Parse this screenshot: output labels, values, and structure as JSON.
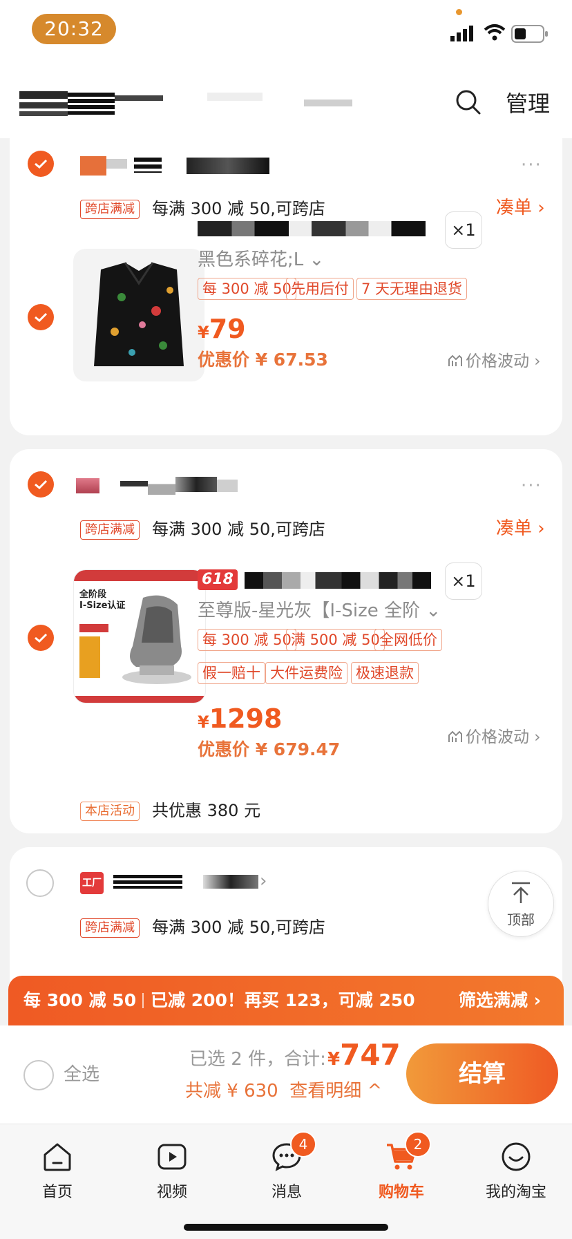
{
  "status_bar": {
    "time": "20:32"
  },
  "header": {
    "manage_label": "管理"
  },
  "stores": [
    {
      "promo_tag": "跨店满减",
      "promo_text": "每满 300 减 50,可跨店",
      "link": "凑单 ›",
      "item": {
        "variant": "黑色系碎花;L ⌄",
        "qty": "×1",
        "tags": [
          "每 300 减 50",
          "先用后付",
          "7 天无理由退货"
        ],
        "price_symbol": "¥",
        "price": "79",
        "deal_price": "优惠价 ¥ 67.53",
        "price_wave": "价格波动 ›"
      }
    },
    {
      "promo_tag": "跨店满减",
      "promo_text": "每满 300 减 50,可跨店",
      "link": "凑单 ›",
      "item": {
        "badge_618": "618",
        "variant": "至尊版-星光灰【I-Size 全阶 ⌄",
        "qty": "×1",
        "tags_row1": [
          "每 300 减 50",
          "满 500 减 50",
          "全网低价"
        ],
        "tags_row2": [
          "假一赔十",
          "大件运费险",
          "极速退款"
        ],
        "price_symbol": "¥",
        "price": "1298",
        "deal_price": "优惠价 ¥ 679.47",
        "price_wave": "价格波动 ›",
        "image_text": {
          "title1": "全阶段",
          "title2": "I-Size认证"
        }
      },
      "store_activity_tag": "本店活动",
      "store_activity_text": "共优惠 380 元"
    },
    {
      "store_icon_text": "工厂",
      "promo_tag": "跨店满减",
      "promo_text": "每满 300 减 50,可跨店"
    }
  ],
  "back_to_top": "顶部",
  "promo_banner": {
    "left": "每 300 减 50",
    "middle": "已减 200！再买 123，可减 250",
    "right": "筛选满减 ›"
  },
  "checkout": {
    "select_all": "全选",
    "selected_total_label": "已选 2 件，合计:",
    "total_symbol": "¥",
    "total": "747",
    "saved": "共减 ¥ 630  查看明细 ^",
    "checkout_button": "结算"
  },
  "tabbar": {
    "tabs": [
      {
        "label": "首页"
      },
      {
        "label": "视频"
      },
      {
        "label": "消息",
        "badge": "4"
      },
      {
        "label": "购物车",
        "badge": "2"
      },
      {
        "label": "我的淘宝"
      }
    ]
  },
  "colors": {
    "accent": "#f05a20",
    "time_pill": "#d6892c"
  }
}
